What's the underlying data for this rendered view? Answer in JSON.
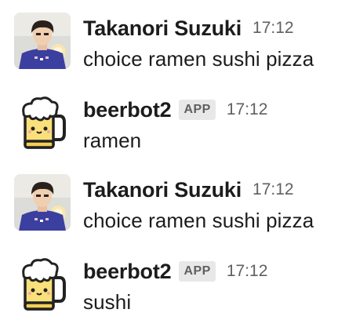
{
  "messages": [
    {
      "author": "Takanori Suzuki",
      "is_app": false,
      "badge": "",
      "time": "17:12",
      "text": "choice ramen sushi pizza",
      "avatar": "person-photo-avatar"
    },
    {
      "author": "beerbot2",
      "is_app": true,
      "badge": "APP",
      "time": "17:12",
      "text": "ramen",
      "avatar": "beer-mug-avatar"
    },
    {
      "author": "Takanori Suzuki",
      "is_app": false,
      "badge": "",
      "time": "17:12",
      "text": "choice ramen sushi pizza",
      "avatar": "person-photo-avatar"
    },
    {
      "author": "beerbot2",
      "is_app": true,
      "badge": "APP",
      "time": "17:12",
      "text": "sushi",
      "avatar": "beer-mug-avatar"
    }
  ],
  "colors": {
    "text": "#1d1c1d",
    "muted": "#616061",
    "badge_bg": "#e8e8e8",
    "beer": "#f9e07a",
    "foam": "#ffffff",
    "shirt": "#3b3fa0"
  }
}
